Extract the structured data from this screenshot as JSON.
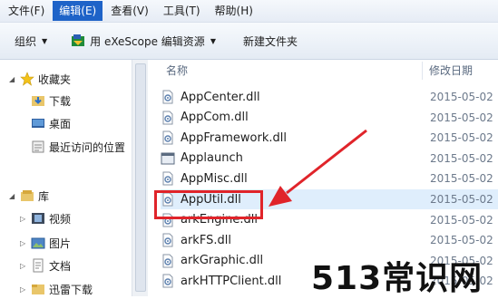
{
  "menu": [
    {
      "label": "文件(F)"
    },
    {
      "label": "编辑(E)",
      "active": true
    },
    {
      "label": "查看(V)"
    },
    {
      "label": "工具(T)"
    },
    {
      "label": "帮助(H)"
    }
  ],
  "toolbar": {
    "organize": "组织",
    "open_with": "用 eXeScope 编辑资源",
    "new_folder": "新建文件夹"
  },
  "nav": {
    "favorites": "收藏夹",
    "downloads": "下载",
    "desktop": "桌面",
    "recent": "最近访问的位置",
    "libraries": "库",
    "videos": "视频",
    "pictures": "图片",
    "documents": "文档",
    "thunder": "迅雷下载"
  },
  "list": {
    "col_name": "名称",
    "col_date": "修改日期",
    "files": [
      {
        "name": "AppCenter.dll",
        "date": "2015-05-02",
        "icon": "dll-icon"
      },
      {
        "name": "AppCom.dll",
        "date": "2015-05-02",
        "icon": "dll-icon"
      },
      {
        "name": "AppFramework.dll",
        "date": "2015-05-02",
        "icon": "dll-icon"
      },
      {
        "name": "Applaunch",
        "date": "2015-05-02",
        "icon": "exe-icon"
      },
      {
        "name": "AppMisc.dll",
        "date": "2015-05-02",
        "icon": "dll-icon"
      },
      {
        "name": "AppUtil.dll",
        "date": "2015-05-02",
        "icon": "dll-icon",
        "selected": true
      },
      {
        "name": "arkEngine.dll",
        "date": "2015-05-02",
        "icon": "dll-icon"
      },
      {
        "name": "arkFS.dll",
        "date": "2015-05-02",
        "icon": "dll-icon"
      },
      {
        "name": "arkGraphic.dll",
        "date": "2015-05-02",
        "icon": "dll-icon"
      },
      {
        "name": "arkHTTPClient.dll",
        "date": "2015-05-02",
        "icon": "dll-icon"
      }
    ]
  },
  "watermark": "513常识网",
  "colors": {
    "annotation": "#e0242a",
    "menu_active": "#1e63c8",
    "selection": "#dfeefc"
  }
}
